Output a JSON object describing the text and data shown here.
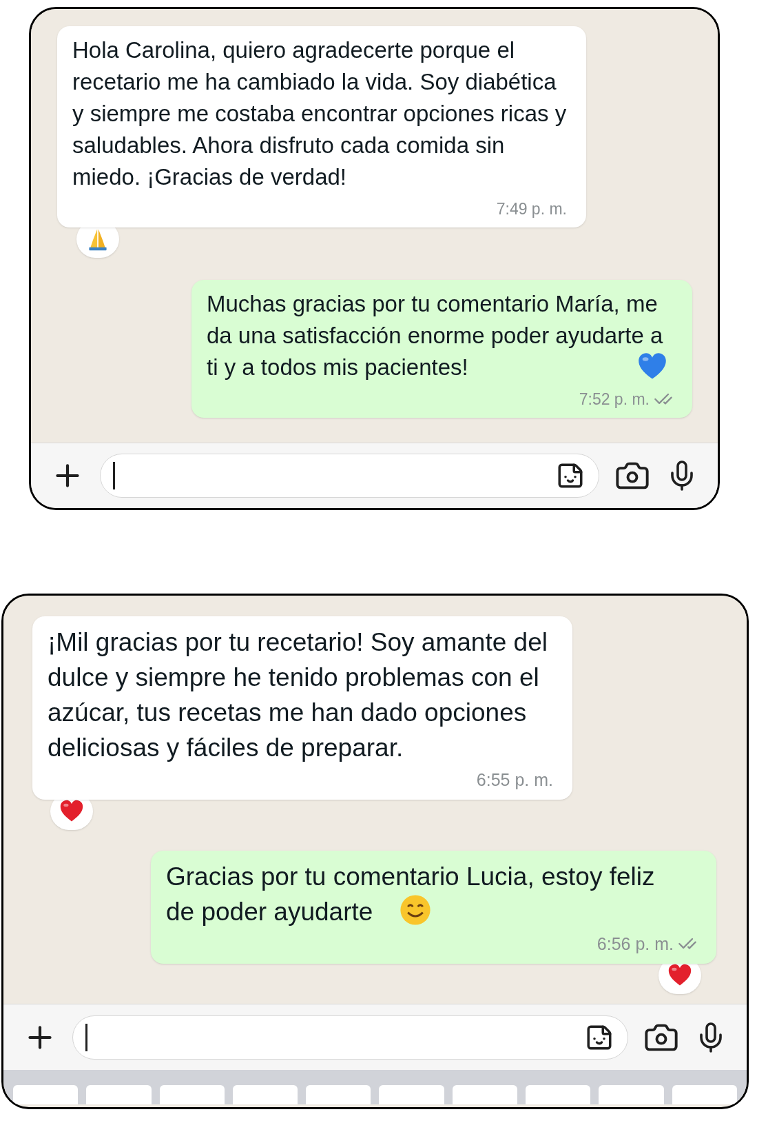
{
  "panels": [
    {
      "messages": [
        {
          "kind": "incoming",
          "text": "Hola Carolina, quiero agradecerte porque el recetario me ha cambiado la vida. Soy diabética y siempre me costaba encontrar opciones ricas y saludables. Ahora disfruto cada comida sin miedo. ¡Gracias de verdad!",
          "time": "7:49 p. m.",
          "reaction": {
            "kind": "pray"
          }
        },
        {
          "kind": "outgoing",
          "text": "Muchas gracias por tu comentario María, me da una satisfacción enorme poder ayudarte a ti y a todos mis pacientes!",
          "emoji": {
            "kind": "blue_heart"
          },
          "time": "7:52 p. m.",
          "read": true
        }
      ],
      "keyboard_visible": false
    },
    {
      "messages": [
        {
          "kind": "incoming",
          "text": "¡Mil gracias por tu recetario! Soy amante del dulce y siempre he tenido problemas con el azúcar, tus recetas me han dado opciones deliciosas y fáciles de preparar.",
          "time": "6:55 p. m.",
          "reaction": {
            "kind": "heart"
          }
        },
        {
          "kind": "outgoing",
          "text": "Gracias por tu comentario Lucia, estoy feliz de poder ayudarte",
          "emoji": {
            "kind": "smile"
          },
          "time": "6:56 p. m.",
          "read": true,
          "reaction": {
            "kind": "heart"
          }
        }
      ],
      "keyboard_visible": true
    }
  ]
}
